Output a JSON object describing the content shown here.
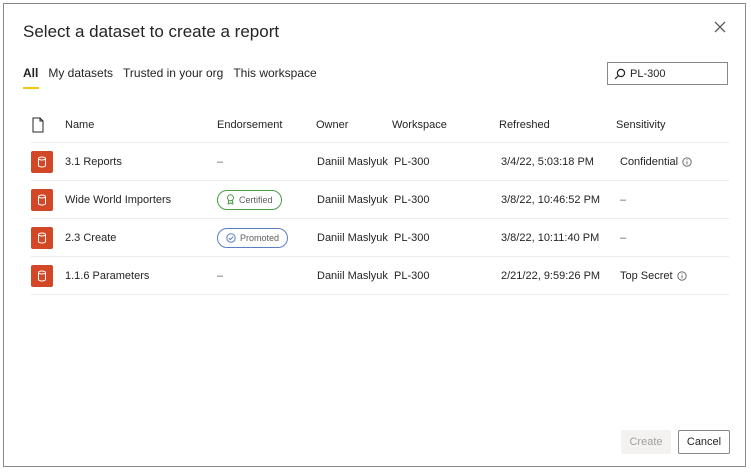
{
  "dialog": {
    "title": "Select a dataset to create a report",
    "close_icon": "close-icon"
  },
  "tabs": [
    {
      "label": "All",
      "active": true
    },
    {
      "label": "My datasets",
      "active": false
    },
    {
      "label": "Trusted in your org",
      "active": false
    },
    {
      "label": "This workspace",
      "active": false
    }
  ],
  "search": {
    "value": "PL-300",
    "icon": "search-icon"
  },
  "table": {
    "columns": {
      "type_icon": "document-icon",
      "name": "Name",
      "endorsement": "Endorsement",
      "owner": "Owner",
      "workspace": "Workspace",
      "refreshed": "Refreshed",
      "sensitivity": "Sensitivity"
    },
    "rows": [
      {
        "name": "3.1 Reports",
        "endorsement": "–",
        "owner": "Daniil Maslyuk",
        "workspace": "PL-300",
        "refreshed": "3/4/22, 5:03:18 PM",
        "sensitivity": "Confidential"
      },
      {
        "name": "Wide World Importers",
        "endorsement": "Certified",
        "owner": "Daniil Maslyuk",
        "workspace": "PL-300",
        "refreshed": "3/8/22, 10:46:52 PM",
        "sensitivity": "–"
      },
      {
        "name": "2.3 Create",
        "endorsement": "Promoted",
        "owner": "Daniil Maslyuk",
        "workspace": "PL-300",
        "refreshed": "3/8/22, 10:11:40 PM",
        "sensitivity": "–"
      },
      {
        "name": "1.1.6 Parameters",
        "endorsement": "–",
        "owner": "Daniil Maslyuk",
        "workspace": "PL-300",
        "refreshed": "2/21/22, 9:59:26 PM",
        "sensitivity": "Top Secret"
      }
    ]
  },
  "footer": {
    "create_label": "Create",
    "cancel_label": "Cancel"
  },
  "colors": {
    "accent": "#f2c811",
    "dataset_icon": "#d24726",
    "certified": "#4d9a48",
    "promoted": "#5b7fc4"
  }
}
